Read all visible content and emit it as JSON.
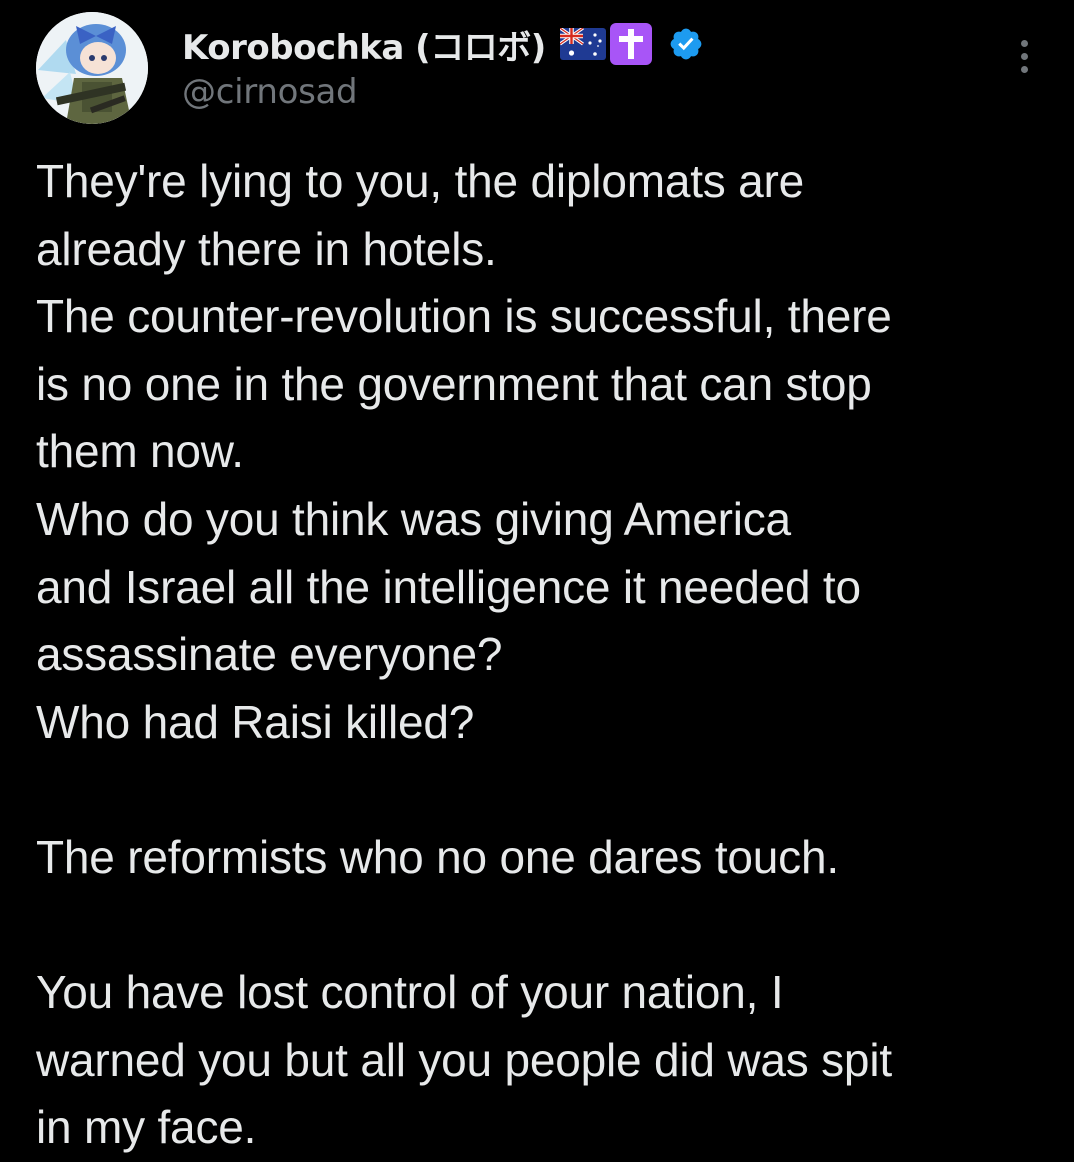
{
  "author": {
    "display_name": "Korobochka (コロボ)",
    "handle": "@cirnosad",
    "badges": [
      "australia-flag-icon",
      "latin-cross-icon",
      "verified-badge-icon"
    ],
    "verified_color": "#1d9bf0"
  },
  "tweet": {
    "lines": [
      "They're lying to you, the diplomats are",
      "already there in hotels.",
      "The counter-revolution is successful, there",
      "is no one in the government that can stop",
      "them now.",
      "Who do you think was giving America",
      "and Israel all the intelligence it needed to",
      "assassinate everyone?",
      "Who had Raisi killed?",
      "",
      "The reformists who no one dares touch.",
      "",
      "You have lost control of your nation, I",
      "warned you but all you people did was spit",
      "in my face."
    ]
  },
  "colors": {
    "background": "#000000",
    "text_primary": "#e7e9ea",
    "text_secondary": "#71767b",
    "accent": "#1d9bf0",
    "cross_badge": "#a855f7"
  }
}
